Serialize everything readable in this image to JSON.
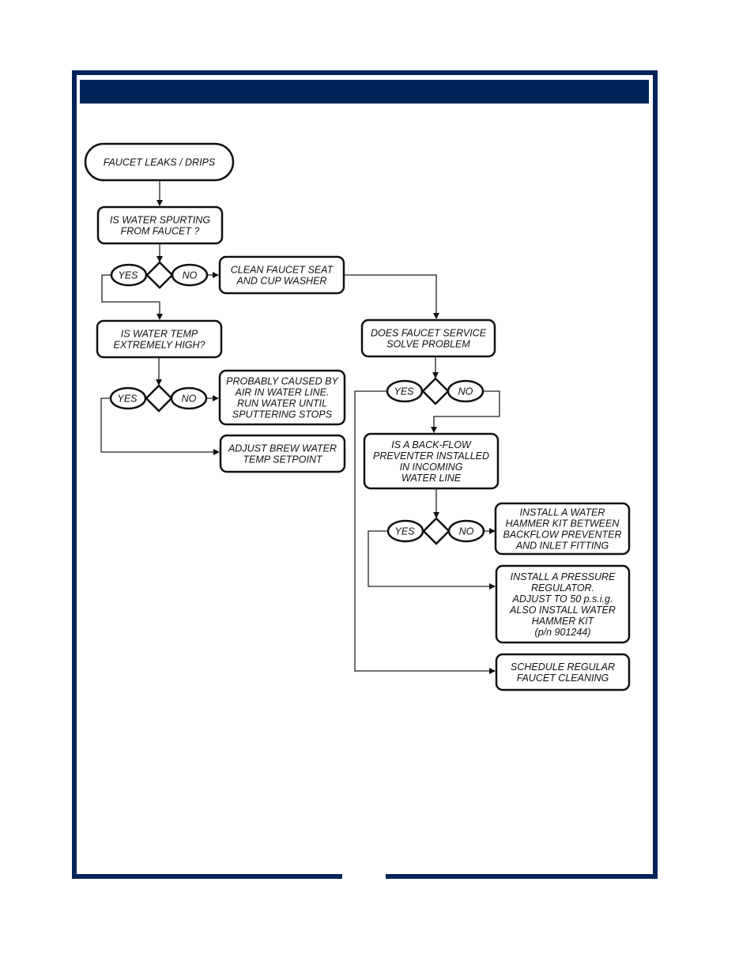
{
  "document": {
    "header_title": "",
    "accent_color": "#00245a"
  },
  "flowchart": {
    "start": {
      "id": "start",
      "lines": [
        "FAUCET LEAKS / DRIPS"
      ]
    },
    "nodes": [
      {
        "id": "q1",
        "lines": [
          "IS WATER SPURTING",
          "FROM FAUCET ?"
        ]
      },
      {
        "id": "a1",
        "lines": [
          "CLEAN FAUCET SEAT",
          "AND CUP WASHER"
        ]
      },
      {
        "id": "q2",
        "lines": [
          "IS WATER TEMP",
          "EXTREMELY HIGH?"
        ]
      },
      {
        "id": "a2",
        "lines": [
          "PROBABLY CAUSED BY",
          "AIR IN WATER LINE.",
          "RUN WATER UNTIL",
          "SPUTTERING STOPS"
        ]
      },
      {
        "id": "a3",
        "lines": [
          "ADJUST BREW WATER",
          "TEMP SETPOINT"
        ]
      },
      {
        "id": "q3",
        "lines": [
          "DOES FAUCET SERVICE",
          "SOLVE PROBLEM"
        ]
      },
      {
        "id": "q4",
        "lines": [
          "IS A BACK-FLOW",
          "PREVENTER INSTALLED",
          "IN INCOMING",
          "WATER LINE"
        ]
      },
      {
        "id": "a4",
        "lines": [
          "INSTALL A WATER",
          "HAMMER KIT BETWEEN",
          "BACKFLOW PREVENTER",
          "AND INLET FITTING"
        ]
      },
      {
        "id": "a5",
        "lines": [
          "INSTALL A PRESSURE",
          "REGULATOR.",
          "ADJUST TO 50 p.s.i.g.",
          "ALSO INSTALL WATER",
          "HAMMER KIT",
          "(p/n 901244)"
        ]
      },
      {
        "id": "a6",
        "lines": [
          "SCHEDULE REGULAR",
          "FAUCET CLEANING"
        ]
      }
    ],
    "decisions": [
      {
        "id": "d1",
        "yes": "YES",
        "no": "NO"
      },
      {
        "id": "d2",
        "yes": "YES",
        "no": "NO"
      },
      {
        "id": "d3",
        "yes": "YES",
        "no": "NO"
      },
      {
        "id": "d4",
        "yes": "YES",
        "no": "NO"
      }
    ],
    "edges": [
      {
        "from": "start",
        "to": "q1"
      },
      {
        "from": "q1",
        "to": "d1"
      },
      {
        "from": "d1",
        "branch": "NO",
        "to": "a1"
      },
      {
        "from": "d1",
        "branch": "YES",
        "to": "q2"
      },
      {
        "from": "a1",
        "to": "q3"
      },
      {
        "from": "q2",
        "to": "d2"
      },
      {
        "from": "d2",
        "branch": "NO",
        "to": "a2"
      },
      {
        "from": "d2",
        "branch": "YES",
        "to": "a3"
      },
      {
        "from": "q3",
        "to": "d3"
      },
      {
        "from": "d3",
        "branch": "NO",
        "to": "q4"
      },
      {
        "from": "d3",
        "branch": "YES",
        "to": "a6"
      },
      {
        "from": "q4",
        "to": "d4"
      },
      {
        "from": "d4",
        "branch": "NO",
        "to": "a4"
      },
      {
        "from": "d4",
        "branch": "YES",
        "to": "a5"
      }
    ]
  }
}
